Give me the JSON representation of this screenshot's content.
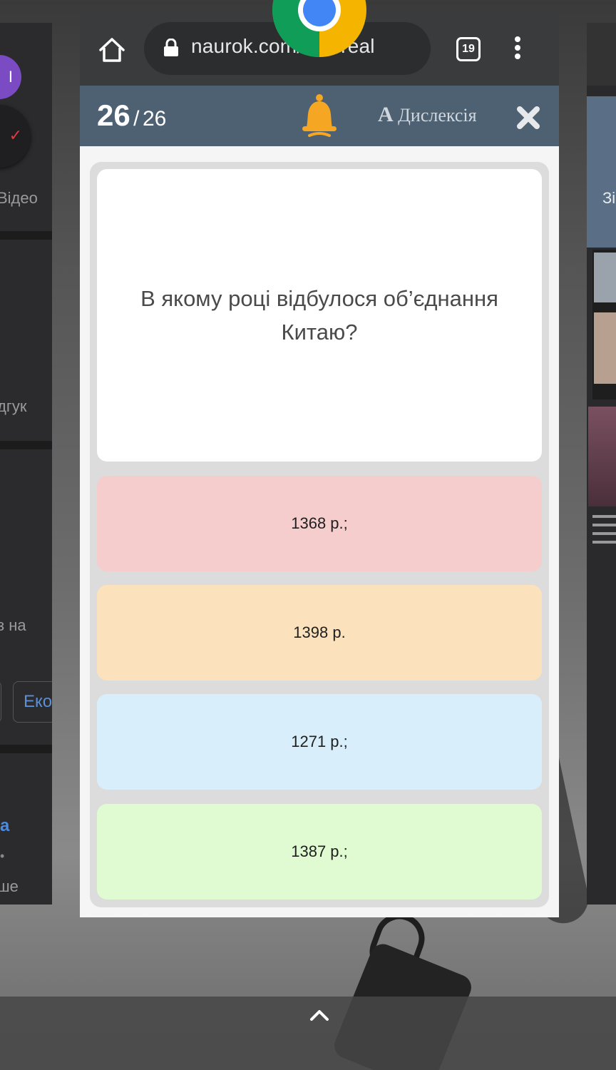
{
  "browser": {
    "url": "naurok.com/test/real",
    "tab_count": "19"
  },
  "quiz": {
    "current": "26",
    "separator": "/",
    "total": "26",
    "dyslexia_label": "Дислексія",
    "dyslexia_glyph": "A",
    "question": "В якому році відбулося об’єднання Китаю?",
    "answers": [
      "1368 р.;",
      "1398 р.",
      "1271 р.;",
      "1387 р.;"
    ]
  },
  "background_cards": {
    "left": {
      "avatar_letter": "І",
      "video_label": "Відео",
      "review_label": "дгук",
      "na_label": "з на",
      "chip_label": "Еко",
      "link_label": "а",
      "dot": "•",
      "more_label": "ше"
    },
    "right": {
      "blue_label": "Зі"
    }
  },
  "colors": {
    "header": "#4d6173",
    "bell": "#f5a623",
    "answer_1": "#f5cdcd",
    "answer_2": "#fbe2bd",
    "answer_3": "#d8eefa",
    "answer_4": "#e0fbd2"
  },
  "icons": [
    "home-icon",
    "lock-icon",
    "tabs-icon",
    "menu-icon",
    "bell-icon",
    "close-icon",
    "chrome-logo",
    "up-chevron-icon"
  ]
}
